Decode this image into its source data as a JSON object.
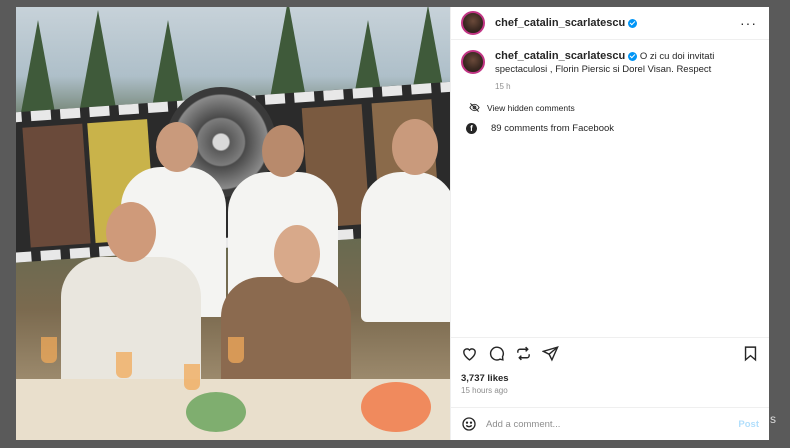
{
  "post": {
    "username": "chef_catalin_scarlatescu",
    "caption_text": "O zi cu doi invitati spectaculosi , Florin Piersic si Dorel Visan. Respect",
    "caption_time": "15 h",
    "view_hidden_comments": "View hidden comments",
    "facebook_comments": "89 comments from Facebook",
    "likes": "3,737 likes",
    "posted_ago": "15 hours ago",
    "more_label": "···"
  },
  "comment_box": {
    "placeholder": "Add a comment...",
    "post_label": "Post"
  },
  "background": {
    "hint_text": "s"
  },
  "icons": {
    "like": "heart-icon",
    "comment": "comment-icon",
    "share": "repost-icon",
    "send": "send-icon",
    "save": "bookmark-icon",
    "emoji": "emoji-icon",
    "hidden": "eye-off-icon",
    "facebook": "facebook-icon"
  },
  "colors": {
    "verified": "#0095f6",
    "post_button": "#b2dffc",
    "text": "#262626",
    "muted": "#8e8e8e"
  }
}
